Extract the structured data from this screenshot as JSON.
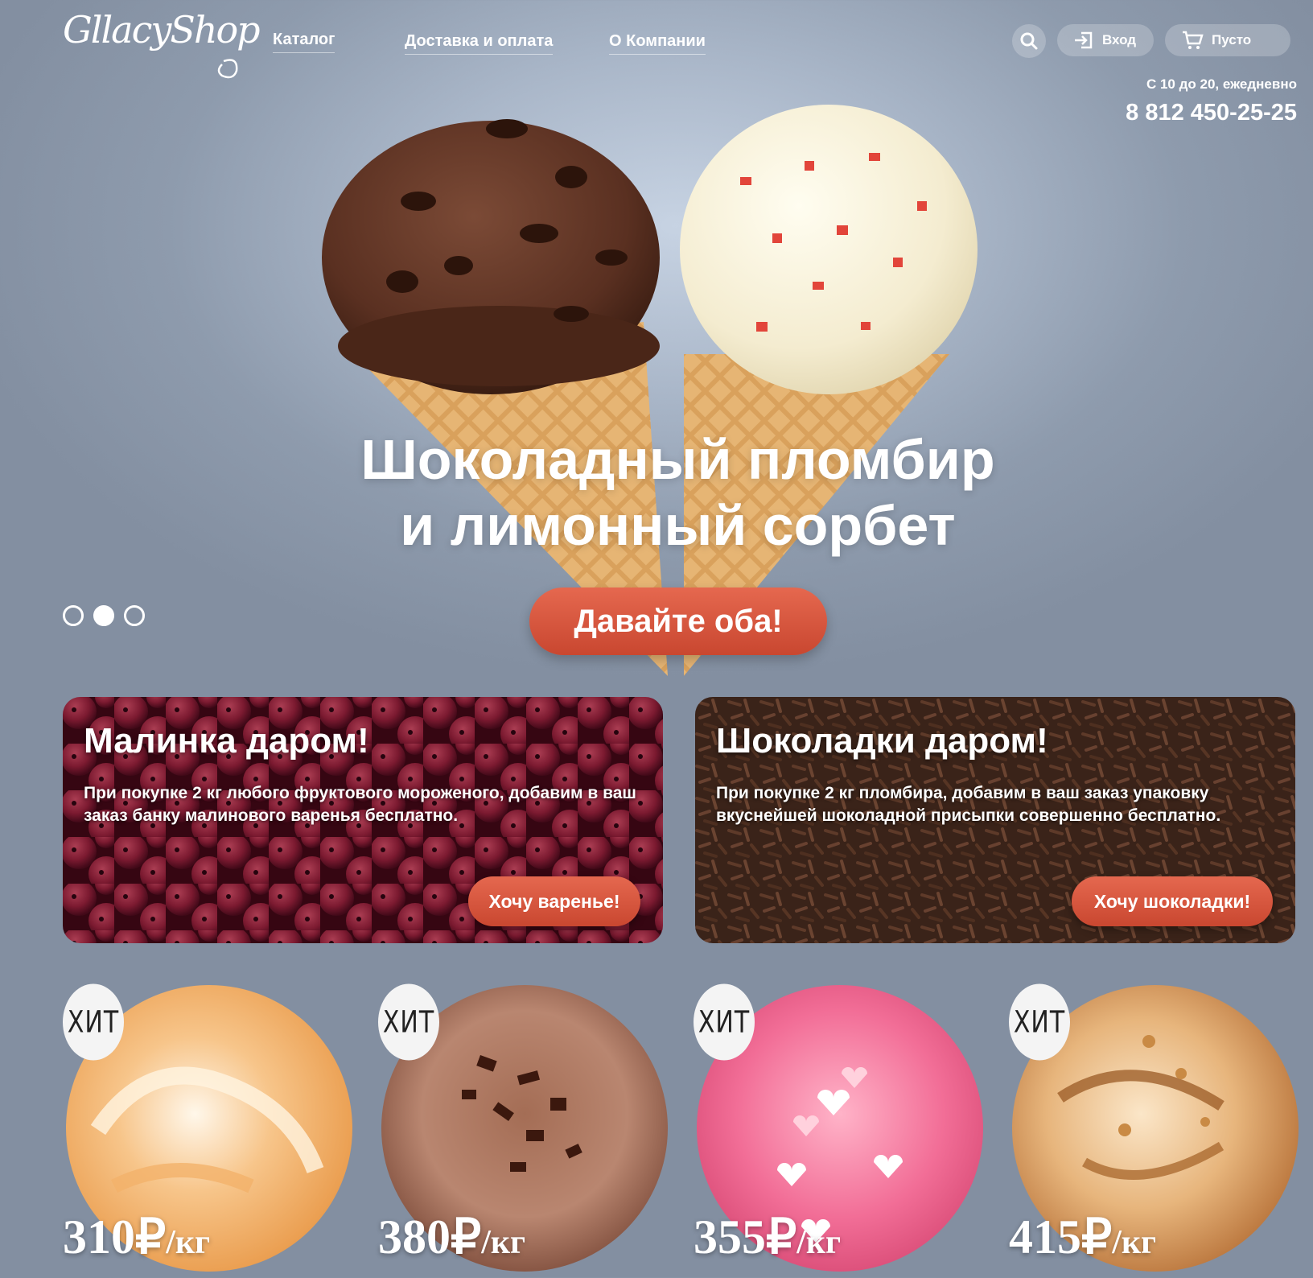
{
  "header": {
    "logo": "GllacyShop",
    "nav": [
      "Каталог",
      "Доставка и оплата",
      "О Компании"
    ],
    "login_label": "Вход",
    "cart_label": "Пусто",
    "hours": "С 10 до 20, ежедневно",
    "phone": "8 812 450-25-25"
  },
  "hero": {
    "title_line1": "Шоколадный пломбир",
    "title_line2": "и лимонный сорбет",
    "cta": "Давайте оба!",
    "slides_total": 3,
    "active_slide": 2
  },
  "promos": [
    {
      "title": "Малинка даром!",
      "description": "При покупке 2 кг любого фруктового мороженого, добавим в ваш заказ банку малинового варенья бесплатно.",
      "button": "Хочу варенье!"
    },
    {
      "title": "Шоколадки даром!",
      "description": "При покупке 2 кг пломбира, добавим в ваш заказ упаковку вкуснейшей шоколадной присыпки совершенно бесплатно.",
      "button": "Хочу шоколадки!"
    }
  ],
  "products": [
    {
      "badge": "ХИТ",
      "price": "310",
      "currency": "₽",
      "unit": "/кг"
    },
    {
      "badge": "ХИТ",
      "price": "380",
      "currency": "₽",
      "unit": "/кг"
    },
    {
      "badge": "ХИТ",
      "price": "355",
      "currency": "₽",
      "unit": "/кг"
    },
    {
      "badge": "ХИТ",
      "price": "415",
      "currency": "₽",
      "unit": "/кг"
    }
  ],
  "colors": {
    "accent": "#d9543b",
    "background": "#8e9bad"
  }
}
